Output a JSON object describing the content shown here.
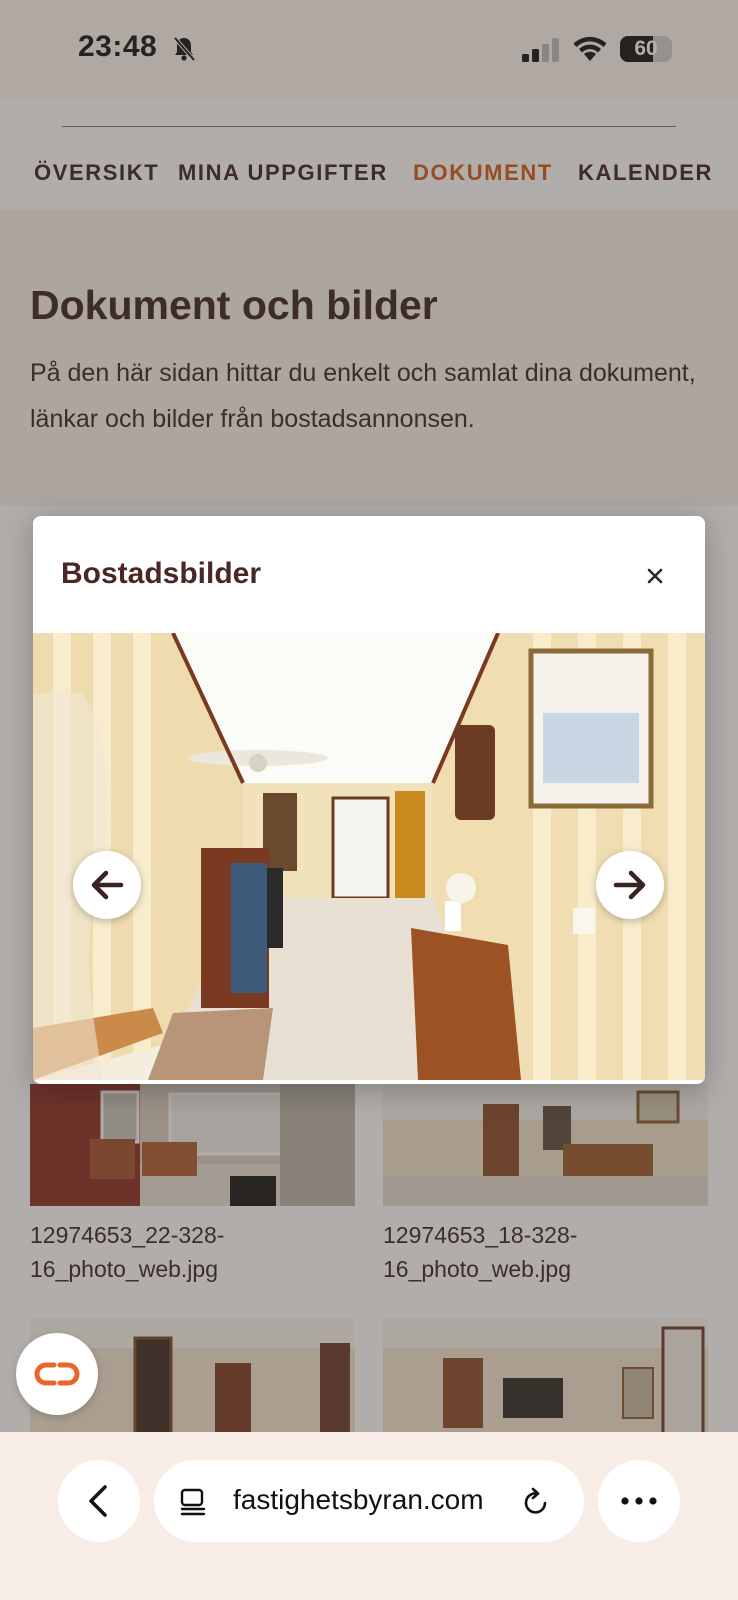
{
  "status_bar": {
    "time": "23:48",
    "battery": "60"
  },
  "tabs": [
    {
      "label": "ÖVERSIKT",
      "active": false
    },
    {
      "label": "MINA UPPGIFTER",
      "active": false
    },
    {
      "label": "DOKUMENT",
      "active": true
    },
    {
      "label": "KALENDER",
      "active": false
    }
  ],
  "page": {
    "title": "Dokument och bilder",
    "description": "På den här sidan hittar du enkelt och samlat dina dokument, länkar och bilder från bostadsannonsen."
  },
  "gallery": {
    "items": [
      {
        "caption": "12974653_22-328-16_photo_web.jpg"
      },
      {
        "caption": "12974653_18-328-16_photo_web.jpg"
      }
    ]
  },
  "modal": {
    "title": "Bostadsbilder"
  },
  "browser": {
    "url": "fastighetsbyran.com"
  },
  "colors": {
    "accent": "#d35a16",
    "text": "#3a2222",
    "toolbar_bg": "#f7ede6"
  }
}
